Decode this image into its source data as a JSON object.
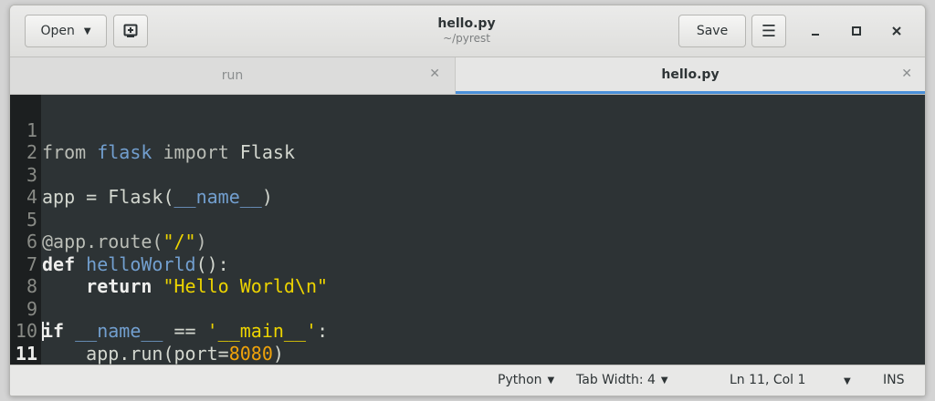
{
  "header": {
    "open_label": "Open",
    "title": "hello.py",
    "subtitle": "~/pyrest",
    "save_label": "Save"
  },
  "tabs": [
    {
      "label": "run",
      "active": false
    },
    {
      "label": "hello.py",
      "active": true
    }
  ],
  "editor": {
    "current_line": 11,
    "lines": [
      {
        "n": "1",
        "text": "from flask import Flask"
      },
      {
        "n": "2",
        "text": ""
      },
      {
        "n": "3",
        "text": "app = Flask(__name__)"
      },
      {
        "n": "4",
        "text": ""
      },
      {
        "n": "5",
        "text": "@app.route(\"/\")"
      },
      {
        "n": "6",
        "text": "def helloWorld():"
      },
      {
        "n": "7",
        "text": "    return \"Hello World\\n\""
      },
      {
        "n": "8",
        "text": ""
      },
      {
        "n": "9",
        "text": "if __name__ == '__main__':"
      },
      {
        "n": "10",
        "text": "    app.run(port=8080)"
      },
      {
        "n": "11",
        "text": ""
      }
    ]
  },
  "statusbar": {
    "language": "Python",
    "tab_width": "Tab Width: 4",
    "position": "Ln 11, Col 1",
    "mode": "INS"
  },
  "icons": {
    "open_dropdown": "chevron-down-icon",
    "new_document": "new-document-icon",
    "menu": "hamburger-menu-icon",
    "minimize": "minimize-icon",
    "maximize": "maximize-icon",
    "close": "close-icon"
  },
  "colors": {
    "editor_background": "#2d3335",
    "gutter_background": "#1c1f20",
    "active_tab_accent": "#4a90d9",
    "string": "#edd400",
    "number": "#f0a30a",
    "identifier": "#729fcf"
  }
}
